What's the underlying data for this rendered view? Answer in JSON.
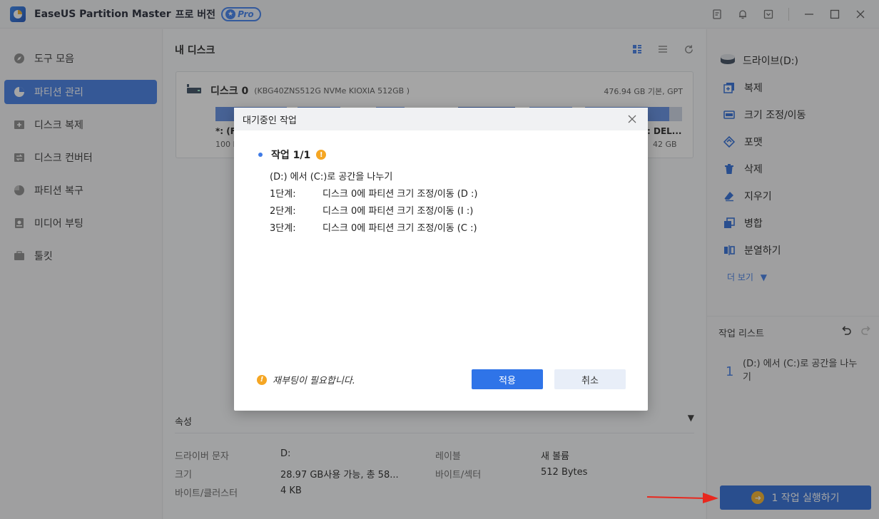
{
  "app": {
    "title": "EaseUS Partition Master",
    "edition": "프로 버전",
    "pro_badge": "Pro"
  },
  "sidebar": {
    "items": [
      {
        "label": "도구 모음",
        "icon": "compass-icon"
      },
      {
        "label": "파티션 관리",
        "icon": "pie-icon",
        "active": true
      },
      {
        "label": "디스크 복제",
        "icon": "clone-icon"
      },
      {
        "label": "디스크 컨버터",
        "icon": "convert-icon"
      },
      {
        "label": "파티션 복구",
        "icon": "recovery-icon"
      },
      {
        "label": "미디어 부팅",
        "icon": "media-icon"
      },
      {
        "label": "툴킷",
        "icon": "toolkit-icon"
      }
    ]
  },
  "center": {
    "title": "내 디스크",
    "disk": {
      "name": "디스크 0",
      "model": "(KBG40ZNS512G NVMe KIOXIA 512GB )",
      "size": "476.94 GB 기본, GPT",
      "left_label": "*: (FA",
      "left_size": "100 M",
      "right_label": ": DEL...",
      "right_size": "42 GB"
    },
    "properties": {
      "title": "속성",
      "rows": [
        {
          "key": "드라이버 문자",
          "value": "D:"
        },
        {
          "key": "크기",
          "value": "28.97 GB사용 가능, 총 58..."
        },
        {
          "key": "바이트/클러스터",
          "value": "4 KB"
        },
        {
          "key": "레이블",
          "value": "새 볼륨"
        },
        {
          "key": "바이트/섹터",
          "value": "512 Bytes"
        }
      ]
    }
  },
  "right": {
    "drive": "드라이브(D:)",
    "actions": [
      {
        "label": "복제",
        "icon": "clone-plus-icon"
      },
      {
        "label": "크기 조정/이동",
        "icon": "resize-icon"
      },
      {
        "label": "포맷",
        "icon": "format-icon"
      },
      {
        "label": "삭제",
        "icon": "trash-icon"
      },
      {
        "label": "지우기",
        "icon": "eraser-icon"
      },
      {
        "label": "병합",
        "icon": "merge-icon"
      },
      {
        "label": "분열하기",
        "icon": "split-icon"
      }
    ],
    "more": "더 보기",
    "task_list_title": "작업 리스트",
    "task_number": "1",
    "task_text": "(D:) 에서 (C:)로 공간을 나누기",
    "run_button": "1 작업 실행하기"
  },
  "modal": {
    "title": "대기중인 작업",
    "job_title": "작업 1/1",
    "description": "(D:) 에서 (C:)로 공간을 나누기",
    "steps": [
      {
        "step": "1단계:",
        "text": "디스크 0에 파티션 크기 조정/이동 (D :)"
      },
      {
        "step": "2단계:",
        "text": "디스크 0에 파티션 크기 조정/이동 (I :)"
      },
      {
        "step": "3단계:",
        "text": "디스크 0에 파티션 크기 조정/이동 (C :)"
      }
    ],
    "reboot_notice": "재부팅이 필요합니다.",
    "apply_label": "적용",
    "cancel_label": "취소"
  },
  "colors": {
    "accent": "#3f7be6",
    "run_button": "#2a6ad8",
    "warning": "#f5a623",
    "partition": "#5d8ce3"
  }
}
